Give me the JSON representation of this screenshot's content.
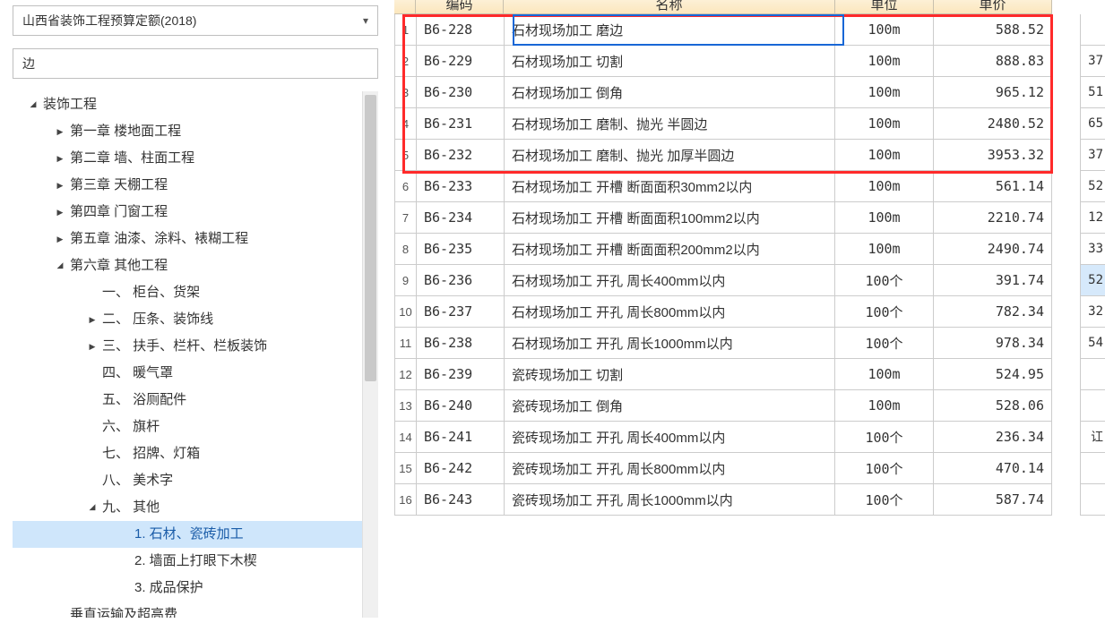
{
  "dropdown": {
    "selected": "山西省装饰工程预算定额(2018)"
  },
  "search": {
    "value": "边"
  },
  "tree": {
    "items": [
      {
        "level": 0,
        "caret": "down",
        "label": "装饰工程"
      },
      {
        "level": 1,
        "caret": "right",
        "label": "第一章 楼地面工程"
      },
      {
        "level": 1,
        "caret": "right",
        "label": "第二章 墙、柱面工程"
      },
      {
        "level": 1,
        "caret": "right",
        "label": "第三章 天棚工程"
      },
      {
        "level": 1,
        "caret": "right",
        "label": "第四章 门窗工程"
      },
      {
        "level": 1,
        "caret": "right",
        "label": "第五章 油漆、涂料、裱糊工程"
      },
      {
        "level": 1,
        "caret": "down",
        "label": "第六章 其他工程"
      },
      {
        "level": 2,
        "caret": "",
        "label": "一、 柜台、货架"
      },
      {
        "level": 2,
        "caret": "right",
        "label": "二、 压条、装饰线"
      },
      {
        "level": 2,
        "caret": "right",
        "label": "三、 扶手、栏杆、栏板装饰"
      },
      {
        "level": 2,
        "caret": "",
        "label": "四、 暖气罩"
      },
      {
        "level": 2,
        "caret": "",
        "label": "五、 浴厕配件"
      },
      {
        "level": 2,
        "caret": "",
        "label": "六、 旗杆"
      },
      {
        "level": 2,
        "caret": "",
        "label": "七、 招牌、灯箱"
      },
      {
        "level": 2,
        "caret": "",
        "label": "八、 美术字"
      },
      {
        "level": 2,
        "caret": "down",
        "label": "九、 其他"
      },
      {
        "level": 3,
        "caret": "",
        "label": "1. 石材、瓷砖加工",
        "selected": true
      },
      {
        "level": 3,
        "caret": "",
        "label": "2. 墙面上打眼下木楔"
      },
      {
        "level": 3,
        "caret": "",
        "label": "3. 成品保护"
      },
      {
        "level": 1,
        "caret": "",
        "label": "垂直运输及超高费"
      }
    ]
  },
  "table": {
    "headers": {
      "code": "编码",
      "name": "名称",
      "unit": "单位",
      "price": "单价"
    },
    "rows": [
      {
        "n": "1",
        "code": "B6-228",
        "name": "石材现场加工 磨边",
        "unit": "100m",
        "price": "588.52"
      },
      {
        "n": "2",
        "code": "B6-229",
        "name": "石材现场加工 切割",
        "unit": "100m",
        "price": "888.83"
      },
      {
        "n": "3",
        "code": "B6-230",
        "name": "石材现场加工 倒角",
        "unit": "100m",
        "price": "965.12"
      },
      {
        "n": "4",
        "code": "B6-231",
        "name": "石材现场加工 磨制、抛光 半圆边",
        "unit": "100m",
        "price": "2480.52"
      },
      {
        "n": "5",
        "code": "B6-232",
        "name": "石材现场加工 磨制、抛光 加厚半圆边",
        "unit": "100m",
        "price": "3953.32"
      },
      {
        "n": "6",
        "code": "B6-233",
        "name": "石材现场加工 开槽 断面面积30mm2以内",
        "unit": "100m",
        "price": "561.14"
      },
      {
        "n": "7",
        "code": "B6-234",
        "name": "石材现场加工 开槽 断面面积100mm2以内",
        "unit": "100m",
        "price": "2210.74"
      },
      {
        "n": "8",
        "code": "B6-235",
        "name": "石材现场加工 开槽 断面面积200mm2以内",
        "unit": "100m",
        "price": "2490.74"
      },
      {
        "n": "9",
        "code": "B6-236",
        "name": "石材现场加工 开孔 周长400mm以内",
        "unit": "100个",
        "price": "391.74"
      },
      {
        "n": "10",
        "code": "B6-237",
        "name": "石材现场加工 开孔 周长800mm以内",
        "unit": "100个",
        "price": "782.34"
      },
      {
        "n": "11",
        "code": "B6-238",
        "name": "石材现场加工 开孔 周长1000mm以内",
        "unit": "100个",
        "price": "978.34"
      },
      {
        "n": "12",
        "code": "B6-239",
        "name": "瓷砖现场加工 切割",
        "unit": "100m",
        "price": "524.95"
      },
      {
        "n": "13",
        "code": "B6-240",
        "name": "瓷砖现场加工 倒角",
        "unit": "100m",
        "price": "528.06"
      },
      {
        "n": "14",
        "code": "B6-241",
        "name": "瓷砖现场加工 开孔 周长400mm以内",
        "unit": "100个",
        "price": "236.34"
      },
      {
        "n": "15",
        "code": "B6-242",
        "name": "瓷砖现场加工 开孔 周长800mm以内",
        "unit": "100个",
        "price": "470.14"
      },
      {
        "n": "16",
        "code": "B6-243",
        "name": "瓷砖现场加工 开孔 周长1000mm以内",
        "unit": "100个",
        "price": "587.74"
      }
    ]
  },
  "extra_col": {
    "values": [
      "",
      "37",
      "51",
      "65",
      "37",
      "52",
      "12",
      "33",
      "52",
      "32",
      "54",
      "",
      "",
      "讧",
      "",
      ""
    ],
    "highlight_index": 8
  }
}
